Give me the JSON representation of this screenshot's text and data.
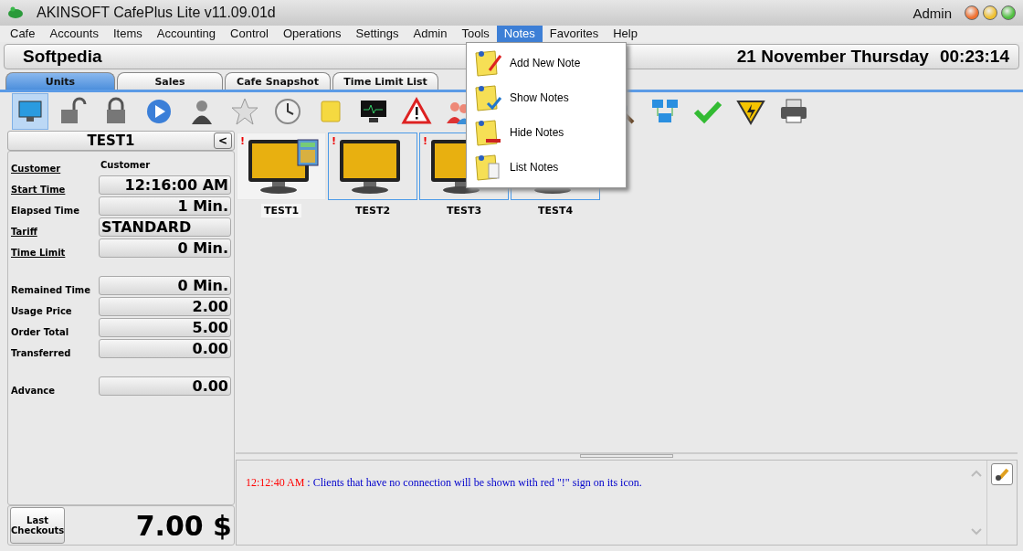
{
  "window": {
    "title": "AKINSOFT CafePlus Lite v11.09.01d",
    "user": "Admin"
  },
  "menu": [
    {
      "label": "Cafe",
      "selected": false
    },
    {
      "label": "Accounts",
      "selected": false
    },
    {
      "label": "Items",
      "selected": false
    },
    {
      "label": "Accounting",
      "selected": false
    },
    {
      "label": "Control",
      "selected": false
    },
    {
      "label": "Operations",
      "selected": false
    },
    {
      "label": "Settings",
      "selected": false
    },
    {
      "label": "Admin",
      "selected": false
    },
    {
      "label": "Tools",
      "selected": false
    },
    {
      "label": "Notes",
      "selected": true
    },
    {
      "label": "Favorites",
      "selected": false
    },
    {
      "label": "Help",
      "selected": false
    }
  ],
  "notes_menu": [
    {
      "label": "Add New Note",
      "kind": "add"
    },
    {
      "label": "Show Notes",
      "kind": "show"
    },
    {
      "label": "Hide Notes",
      "kind": "hide"
    },
    {
      "label": "List Notes",
      "kind": "list"
    }
  ],
  "header": {
    "name": "Softpedia",
    "date": "21 November Thursday",
    "time": "00:23:14"
  },
  "tabs": [
    {
      "label": "Units",
      "selected": true
    },
    {
      "label": "Sales",
      "selected": false
    },
    {
      "label": "Cafe Snapshot",
      "selected": false
    },
    {
      "label": "Time Limit List",
      "selected": false
    }
  ],
  "unit_panel": {
    "title": "TEST1",
    "collapse": "<",
    "fields": [
      {
        "label": "Customer",
        "value": "Customer",
        "linked": true,
        "boxed": false,
        "spaced": false,
        "left_aligned": true
      },
      {
        "label": "Start Time",
        "value": "12:16:00 AM",
        "linked": true,
        "boxed": true,
        "spaced": false,
        "left_aligned": false
      },
      {
        "label": "Elapsed Time",
        "value": "1 Min.",
        "linked": false,
        "boxed": true,
        "spaced": false,
        "left_aligned": false
      },
      {
        "label": "Tariff",
        "value": "STANDARD",
        "linked": true,
        "boxed": true,
        "spaced": false,
        "left_aligned": true
      },
      {
        "label": "Time Limit",
        "value": "0 Min.",
        "linked": true,
        "boxed": true,
        "spaced": false,
        "left_aligned": false
      },
      {
        "label": "Remained Time",
        "value": "0 Min.",
        "linked": false,
        "boxed": true,
        "spaced": true,
        "left_aligned": false
      },
      {
        "label": "Usage Price",
        "value": "2.00",
        "linked": false,
        "boxed": true,
        "spaced": false,
        "left_aligned": false
      },
      {
        "label": "Order Total",
        "value": "5.00",
        "linked": false,
        "boxed": true,
        "spaced": false,
        "left_aligned": false
      },
      {
        "label": "Transferred",
        "value": "0.00",
        "linked": false,
        "boxed": true,
        "spaced": false,
        "left_aligned": false
      },
      {
        "label": "Advance",
        "value": "0.00",
        "linked": false,
        "boxed": true,
        "spaced": true,
        "left_aligned": false
      }
    ],
    "checkouts_button": "Last Checkouts",
    "total": "7.00 $"
  },
  "units": [
    {
      "name": "TEST1",
      "selected": true,
      "alert_sign": "!",
      "has_order": true
    },
    {
      "name": "TEST2",
      "selected": false,
      "alert_sign": "!",
      "has_order": false
    },
    {
      "name": "TEST3",
      "selected": false,
      "alert_sign": "!"
    },
    {
      "name": "TEST4",
      "selected": false
    }
  ],
  "log": [
    {
      "time": "12:12:40 AM",
      "message": ": Clients that have no connection will be shown with red \"!\" sign on its icon."
    }
  ]
}
